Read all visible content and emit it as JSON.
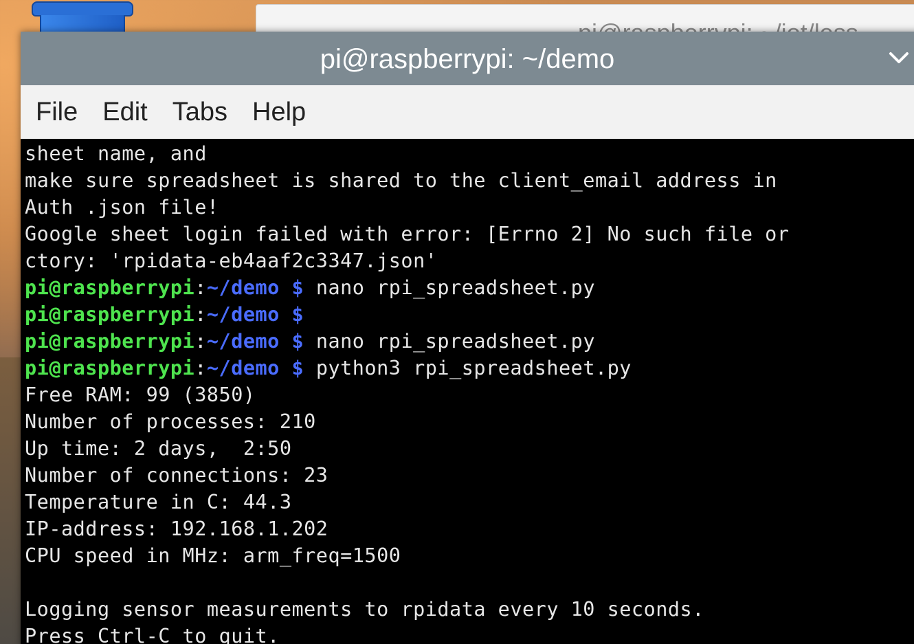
{
  "background_window": {
    "title": "pi@raspberrypi: ~/iot/less"
  },
  "terminal": {
    "title": "pi@raspberrypi: ~/demo",
    "menu": [
      "File",
      "Edit",
      "Tabs",
      "Help"
    ],
    "output_lines_top": [
      "sheet name, and",
      "make sure spreadsheet is shared to the client_email address in",
      "Auth .json file!",
      "Google sheet login failed with error: [Errno 2] No such file or",
      "ctory: 'rpidata-eb4aaf2c3347.json'"
    ],
    "prompts": [
      {
        "user": "pi@raspberrypi",
        "colon": ":",
        "path": "~/demo",
        "dollar": " $",
        "cmd": " nano rpi_spreadsheet.py"
      },
      {
        "user": "pi@raspberrypi",
        "colon": ":",
        "path": "~/demo",
        "dollar": " $",
        "cmd": ""
      },
      {
        "user": "pi@raspberrypi",
        "colon": ":",
        "path": "~/demo",
        "dollar": " $",
        "cmd": " nano rpi_spreadsheet.py"
      },
      {
        "user": "pi@raspberrypi",
        "colon": ":",
        "path": "~/demo",
        "dollar": " $",
        "cmd": " python3 rpi_spreadsheet.py"
      }
    ],
    "output_lines_bottom": [
      "Free RAM: 99 (3850)",
      "Number of processes: 210",
      "Up time: 2 days,  2:50",
      "Number of connections: 23",
      "Temperature in C: 44.3",
      "IP-address: 192.168.1.202",
      "CPU speed in MHz: arm_freq=1500",
      "",
      "Logging sensor measurements to rpidata every 10 seconds.",
      "Press Ctrl-C to quit."
    ]
  },
  "colors": {
    "prompt_user": "#4ee44e",
    "prompt_path": "#4a6cff",
    "terminal_bg": "#000000",
    "titlebar_bg": "#7d8a92"
  }
}
